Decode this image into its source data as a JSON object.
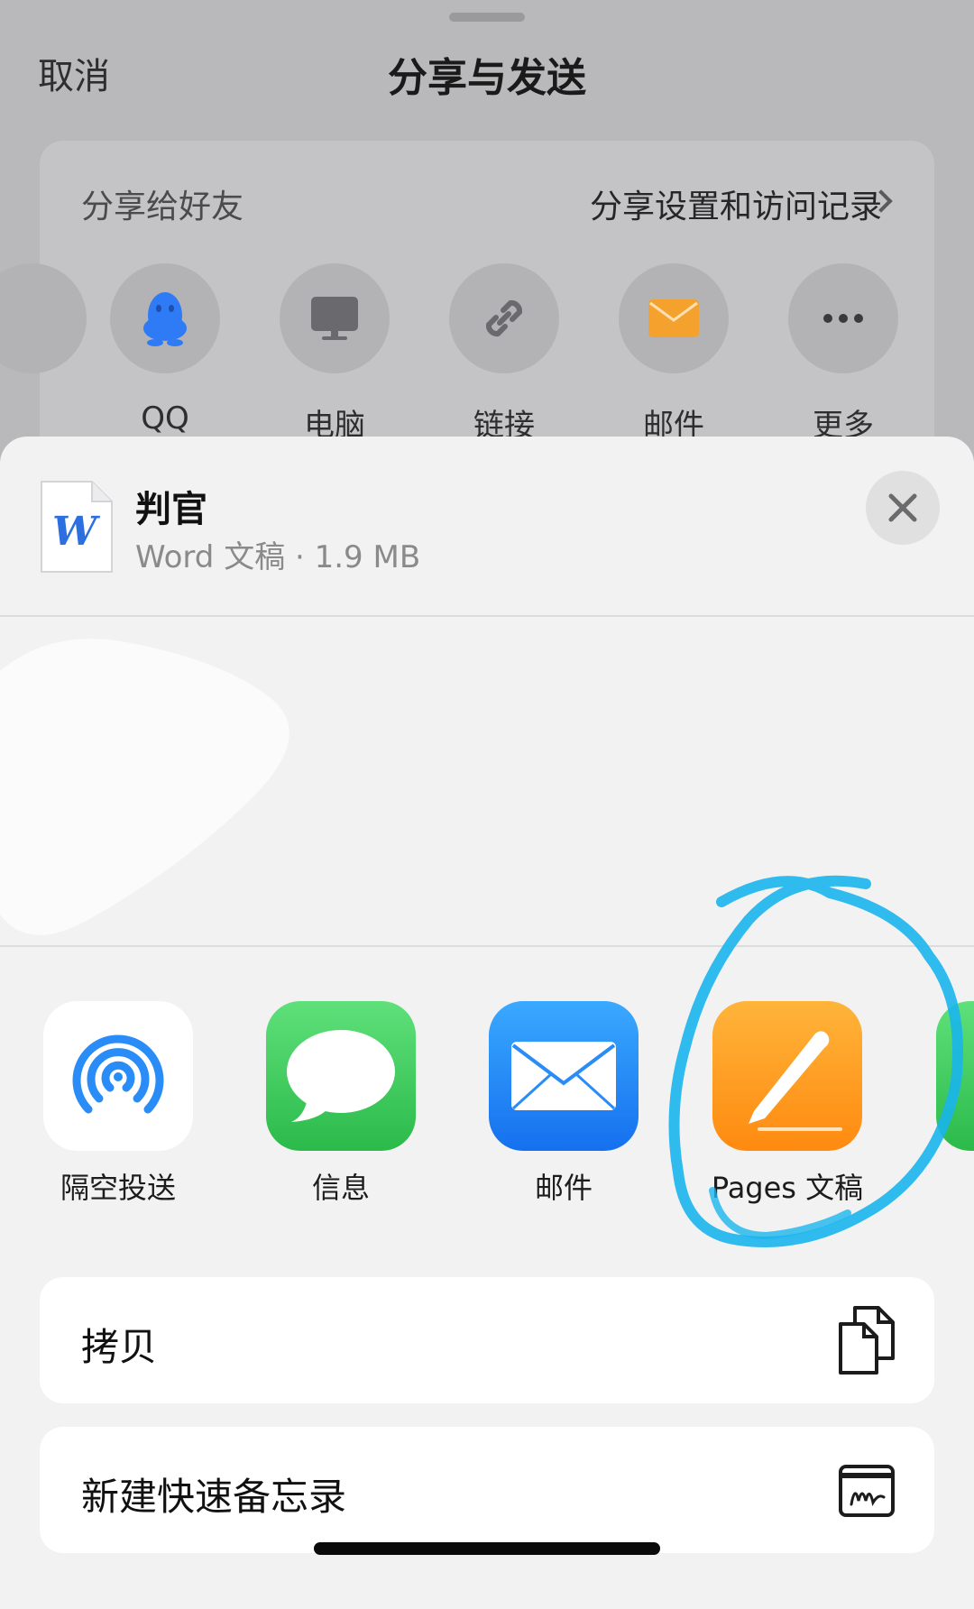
{
  "header": {
    "cancel_label": "取消",
    "title": "分享与发送"
  },
  "friends_section": {
    "title": "分享给好友",
    "settings_link": "分享设置和访问记录",
    "items": [
      {
        "label": "QQ",
        "icon": "qq-penguin-icon"
      },
      {
        "label": "电脑",
        "icon": "computer-icon"
      },
      {
        "label": "链接",
        "icon": "link-icon"
      },
      {
        "label": "邮件",
        "icon": "mail-icon"
      },
      {
        "label": "更多",
        "icon": "more-icon"
      }
    ]
  },
  "file": {
    "name": "判官",
    "meta": "Word 文稿 · 1.9 MB",
    "icon_letter": "W"
  },
  "apps": [
    {
      "label": "隔空投送",
      "icon": "airdrop-icon"
    },
    {
      "label": "信息",
      "icon": "messages-icon"
    },
    {
      "label": "邮件",
      "icon": "mail-app-icon"
    },
    {
      "label": "Pages 文稿",
      "icon": "pages-icon"
    }
  ],
  "actions": [
    {
      "label": "拷贝",
      "icon": "copy-icon"
    },
    {
      "label": "新建快速备忘录",
      "icon": "quick-note-icon"
    }
  ],
  "colors": {
    "qq_blue": "#2f7bf6",
    "mail_orange": "#f4a22d",
    "messages_green": "#33c659",
    "mail_blue": "#2a8cf6",
    "pages_orange": "#ff9a1c",
    "annotation_blue": "#1ab5ec"
  }
}
